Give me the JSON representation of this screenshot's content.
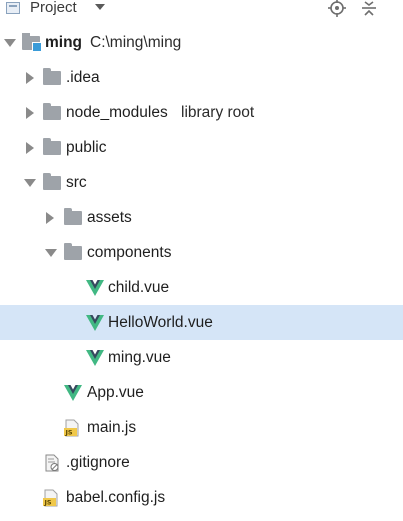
{
  "header": {
    "title": "Project"
  },
  "tree": {
    "root": {
      "name": "ming",
      "path": "C:\\ming\\ming"
    },
    "idea": {
      "name": ".idea"
    },
    "node_modules": {
      "name": "node_modules",
      "suffix": "library root"
    },
    "public": {
      "name": "public"
    },
    "src": {
      "name": "src"
    },
    "assets": {
      "name": "assets"
    },
    "components": {
      "name": "components"
    },
    "child": {
      "name": "child.vue"
    },
    "helloworld": {
      "name": "HelloWorld.vue"
    },
    "mingvue": {
      "name": "ming.vue"
    },
    "app": {
      "name": "App.vue"
    },
    "mainjs": {
      "name": "main.js"
    },
    "gitignore": {
      "name": ".gitignore"
    },
    "babel": {
      "name": "babel.config.js"
    }
  },
  "icons": {
    "vue": "vue-file-icon",
    "js": "js-file-icon",
    "folder": "folder-icon",
    "ignore": "gitignore-file-icon"
  },
  "colors": {
    "selection": "#d5e5f7",
    "vue_green": "#41b883",
    "vue_dark": "#35495e",
    "js_yellow": "#f0c84a",
    "folder_gray": "#9ea3a9",
    "module_blue": "#3a9bd8"
  },
  "selected_item": "HelloWorld.vue"
}
